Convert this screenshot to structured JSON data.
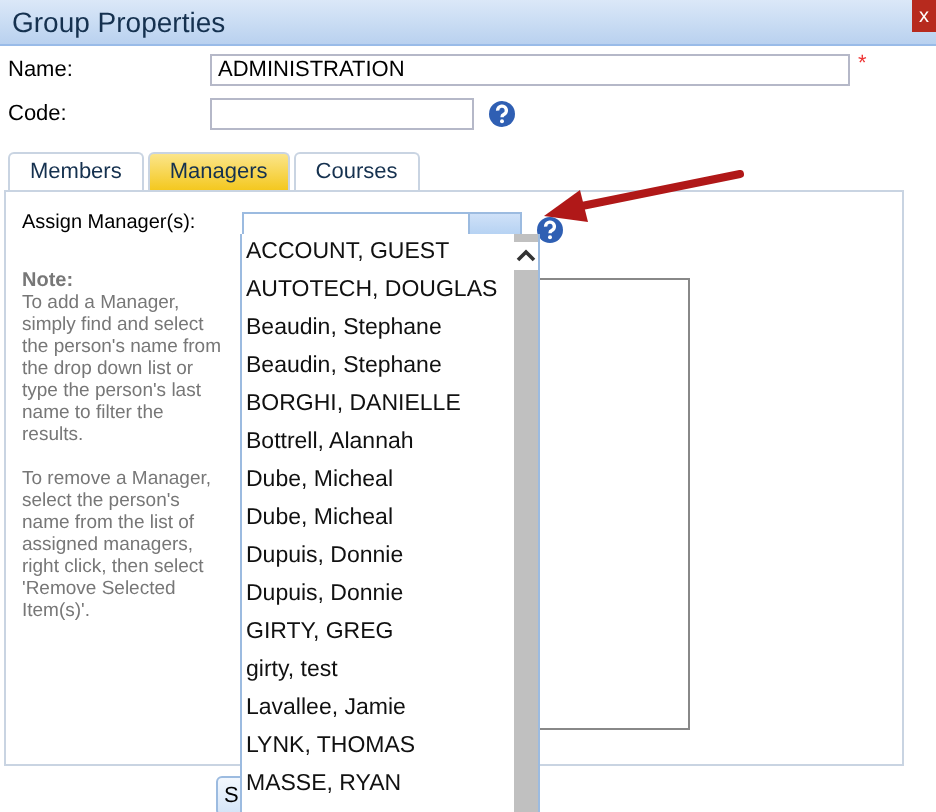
{
  "window": {
    "title": "Group Properties",
    "close": "x"
  },
  "required_mark": "*",
  "fields": [
    {
      "label": "Name:",
      "value": "ADMINISTRATION",
      "required": true,
      "help": false
    },
    {
      "label": "Code:",
      "required": false,
      "help": true
    }
  ],
  "tabs": [
    {
      "label": "Members",
      "selected": false
    },
    {
      "label": "Managers",
      "selected": true
    },
    {
      "label": "Courses",
      "selected": false
    }
  ],
  "assign": {
    "label": "Assign Manager(s):"
  },
  "note": {
    "title": "Note:",
    "paragraphs": [
      "To add a Manager, simply find and select the person's name from the drop down list or type the person's last name to filter the results.",
      "To remove a Manager, select the person's name from the list of assigned managers, right click, then select 'Remove Selected Item(s)'."
    ]
  },
  "dropdown": {
    "expanded": true,
    "items": [
      "ACCOUNT, GUEST",
      "AUTOTECH, DOUGLAS",
      "Beaudin, Stephane",
      "Beaudin, Stephane",
      "BORGHI, DANIELLE",
      "Bottrell, Alannah",
      "Dube, Micheal",
      "Dube, Micheal",
      "Dupuis, Donnie",
      "Dupuis, Donnie",
      "GIRTY, GREG",
      "girty, test",
      "Lavallee, Jamie",
      "LYNK, THOMAS",
      "MASSE, RYAN"
    ]
  },
  "buttons": [
    "S"
  ]
}
